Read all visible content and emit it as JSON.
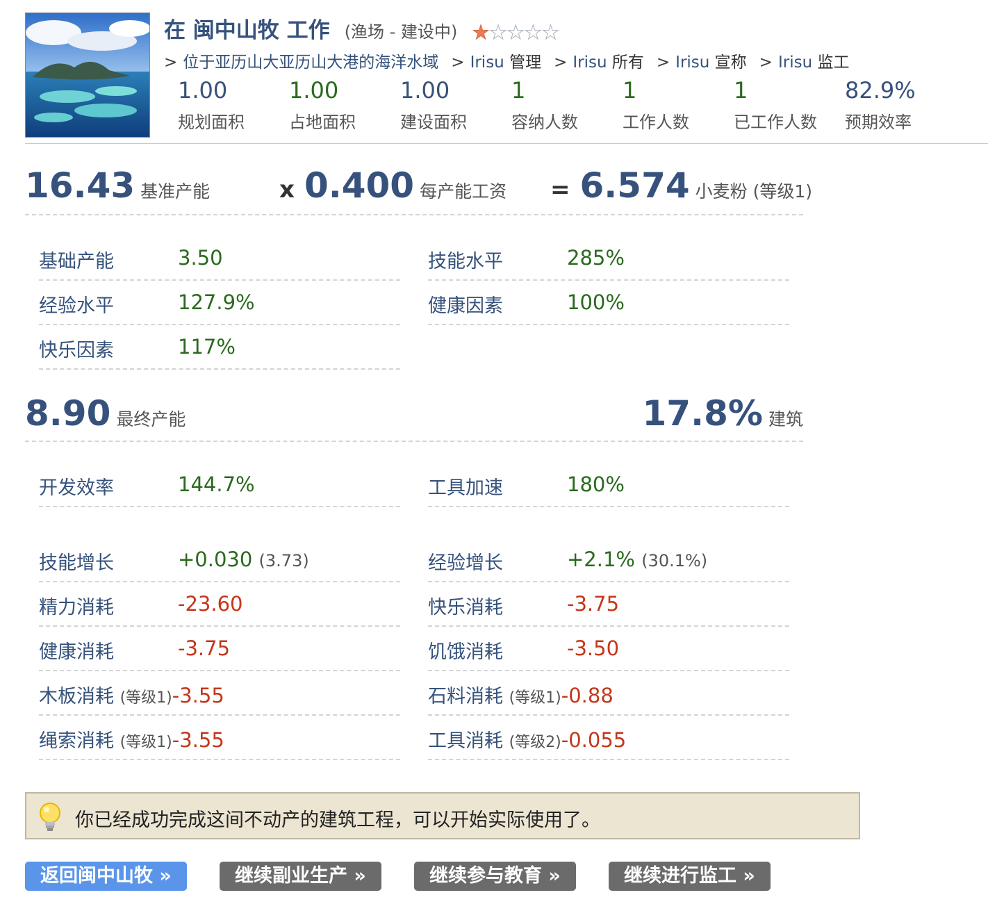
{
  "header": {
    "title": "在 闽中山牧 工作",
    "subtitle": "(渔场 - 建设中)",
    "rating": 1,
    "rating_max": 5,
    "breadcrumb": [
      {
        "link": "",
        "text": "位于亚历山大亚历山大港的海洋水域"
      },
      {
        "link": "Irisu",
        "text": " 管理"
      },
      {
        "link": "Irisu",
        "text": " 所有"
      },
      {
        "link": "Irisu",
        "text": " 宣称"
      },
      {
        "link": "Irisu",
        "text": " 监工"
      }
    ],
    "breadcrumb_sep": ">",
    "stats": [
      {
        "value": "1.00",
        "label": "规划面积"
      },
      {
        "value": "1.00",
        "label": "占地面积"
      },
      {
        "value": "1.00",
        "label": "建设面积"
      },
      {
        "value": "1",
        "label": "容纳人数"
      },
      {
        "value": "1",
        "label": "工作人数"
      },
      {
        "value": "1",
        "label": "已工作人数"
      },
      {
        "value": "82.9%",
        "label": "预期效率"
      }
    ]
  },
  "equation": {
    "base_value": "16.43",
    "base_label": "基准产能",
    "mult_op": "x",
    "wage_value": "0.400",
    "wage_label": "每产能工资",
    "eq_op": "=",
    "result_value": "6.574",
    "result_label": "小麦粉",
    "result_grade": "(等级1)"
  },
  "factors": [
    {
      "label": "基础产能",
      "value": "3.50"
    },
    {
      "label": "技能水平",
      "value": "285%"
    },
    {
      "label": "经验水平",
      "value": "127.9%"
    },
    {
      "label": "健康因素",
      "value": "100%"
    },
    {
      "label": "快乐因素",
      "value": "117%"
    }
  ],
  "final": {
    "output_value": "8.90",
    "output_label": "最终产能",
    "build_value": "17.8%",
    "build_label": "建筑"
  },
  "boosts": [
    {
      "label": "开发效率",
      "value": "144.7%"
    },
    {
      "label": "工具加速",
      "value": "180%"
    }
  ],
  "growth": [
    {
      "label": "技能增长",
      "value": "+0.030",
      "extra": "(3.73)"
    },
    {
      "label": "经验增长",
      "value": "+2.1%",
      "extra": "(30.1%)"
    }
  ],
  "consumption": [
    {
      "label": "精力消耗",
      "grade": "",
      "value": "-23.60"
    },
    {
      "label": "快乐消耗",
      "grade": "",
      "value": "-3.75"
    },
    {
      "label": "健康消耗",
      "grade": "",
      "value": "-3.75"
    },
    {
      "label": "饥饿消耗",
      "grade": "",
      "value": "-3.50"
    },
    {
      "label": "木板消耗",
      "grade": "(等级1)",
      "value": "-3.55"
    },
    {
      "label": "石料消耗",
      "grade": "(等级1)",
      "value": "-0.88"
    },
    {
      "label": "绳索消耗",
      "grade": "(等级1)",
      "value": "-3.55"
    },
    {
      "label": "工具消耗",
      "grade": "(等级2)",
      "value": "-0.055"
    }
  ],
  "notice": {
    "icon": "lightbulb-icon",
    "text": "你已经成功完成这间不动产的建筑工程，可以开始实际使用了。"
  },
  "buttons": [
    {
      "label": "返回闽中山牧 »"
    },
    {
      "label": "继续副业生产 »"
    },
    {
      "label": "继续参与教育 »"
    },
    {
      "label": "继续进行监工 »"
    }
  ],
  "colors": {
    "accent": "#36527c",
    "positive": "#2a6a1d",
    "negative": "#c4361a",
    "button_primary": "#5a95e9",
    "button_gray": "#6b6b6b",
    "notice_bg": "#ece5d2"
  }
}
